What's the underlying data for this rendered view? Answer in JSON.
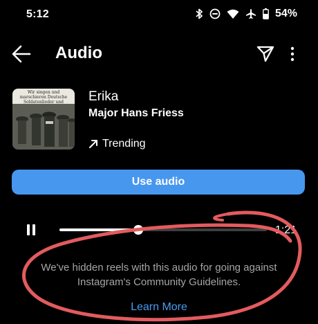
{
  "status_bar": {
    "time": "5:12",
    "battery": "54%",
    "icons": [
      "bluetooth-icon",
      "do-not-disturb-icon",
      "wifi-icon",
      "airplane-mode-icon",
      "battery-icon"
    ]
  },
  "header": {
    "title": "Audio",
    "back_icon": "arrow-left-icon",
    "share_icon": "paper-plane-icon",
    "more_icon": "more-vertical-icon"
  },
  "audio": {
    "cover_text": "Wir singen und marschieren Deutsche Soldatenlieder und Märsche",
    "title": "Erika",
    "artist": "Major Hans Friess",
    "trending_label": "Trending",
    "trending_icon": "arrow-up-right-icon"
  },
  "actions": {
    "use_audio": "Use audio"
  },
  "player": {
    "duration": "1:21",
    "progress": 0.38,
    "pause_icon": "pause-icon"
  },
  "notice": {
    "message": "We've hidden reels with this audio for going against Instagram's Community Guidelines.",
    "learn_more": "Learn More"
  },
  "colors": {
    "background": "#000000",
    "button": "#4897ef",
    "link": "#4a9cf0",
    "annotation": "#e35b5e",
    "muted_text": "#a6a6a6"
  }
}
